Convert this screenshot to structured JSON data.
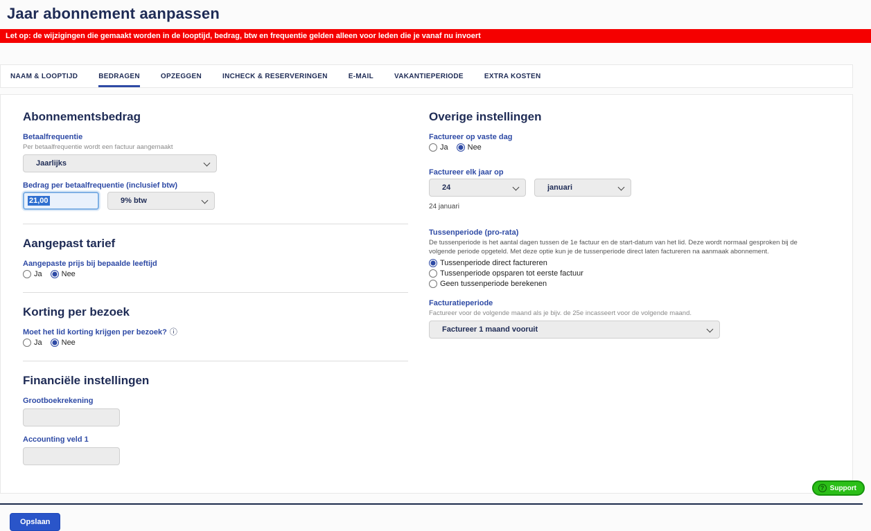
{
  "page": {
    "title": "Jaar abonnement aanpassen",
    "warning": "Let op: de wijzigingen die gemaakt worden in de looptijd, bedrag, btw en frequentie gelden alleen voor leden die je vanaf nu invoert"
  },
  "tabs": [
    {
      "label": "NAAM & LOOPTIJD",
      "active": false
    },
    {
      "label": "BEDRAGEN",
      "active": true
    },
    {
      "label": "OPZEGGEN",
      "active": false
    },
    {
      "label": "INCHECK & RESERVERINGEN",
      "active": false
    },
    {
      "label": "E-MAIL",
      "active": false
    },
    {
      "label": "VAKANTIEPERIODE",
      "active": false
    },
    {
      "label": "EXTRA KOSTEN",
      "active": false
    }
  ],
  "left": {
    "abonnementsbedrag": {
      "heading": "Abonnementsbedrag",
      "betaalfrequentie_label": "Betaalfrequentie",
      "betaalfrequentie_help": "Per betaalfrequentie wordt een factuur aangemaakt",
      "betaalfrequentie_value": "Jaarlijks",
      "bedrag_label": "Bedrag per betaalfrequentie (inclusief btw)",
      "bedrag_value": "21,00",
      "btw_value": "9% btw"
    },
    "aangepast_tarief": {
      "heading": "Aangepast tarief",
      "label": "Aangepaste prijs bij bepaalde leeftijd",
      "ja": "Ja",
      "nee": "Nee",
      "ja_checked": false,
      "nee_checked": true
    },
    "korting": {
      "heading": "Korting per bezoek",
      "label": "Moet het lid korting krijgen per bezoek?",
      "ja": "Ja",
      "nee": "Nee",
      "ja_checked": false,
      "nee_checked": true
    },
    "financieel": {
      "heading": "Financiële instellingen",
      "grootboek_label": "Grootboekrekening",
      "accounting_label": "Accounting veld 1"
    }
  },
  "right": {
    "heading": "Overige instellingen",
    "vaste_dag": {
      "label": "Factureer op vaste dag",
      "ja": "Ja",
      "nee": "Nee",
      "ja_checked": false,
      "nee_checked": true
    },
    "elk_jaar": {
      "label": "Factureer elk jaar op",
      "day_value": "24",
      "month_value": "januari",
      "summary": "24 januari"
    },
    "tussenperiode": {
      "label": "Tussenperiode (pro-rata)",
      "help": "De tussenperiode is het aantal dagen tussen de 1e factuur en de start-datum van het lid. Deze wordt normaal gesproken bij de volgende periode opgeteld. Met deze optie kun je de tussenperiode direct laten factureren na aanmaak abonnement.",
      "options": [
        {
          "label": "Tussenperiode direct factureren",
          "selected": true
        },
        {
          "label": "Tussenperiode opsparen tot eerste factuur",
          "selected": false
        },
        {
          "label": "Geen tussenperiode berekenen",
          "selected": false
        }
      ]
    },
    "facturatieperiode": {
      "label": "Facturatieperiode",
      "help": "Factureer voor de volgende maand als je bijv. de 25e incasseert voor de volgende maand.",
      "value": "Factureer 1 maand vooruit"
    }
  },
  "footer": {
    "save_label": "Opslaan",
    "support_label": "Support"
  },
  "icons": {
    "info": "ⓘ",
    "question": "?"
  },
  "colors": {
    "accent_blue": "#2e4aa5",
    "navy": "#1e2b55",
    "warning_red": "#f50000",
    "support_green": "#2bbf18",
    "save_blue": "#2a55c9"
  }
}
